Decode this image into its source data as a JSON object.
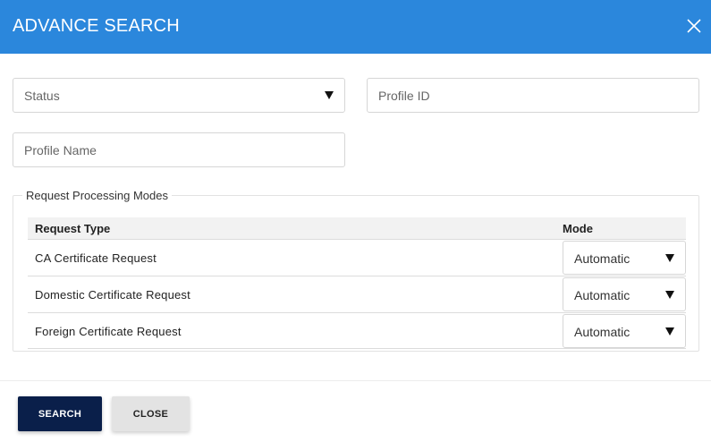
{
  "dialog": {
    "title": "ADVANCE SEARCH",
    "close_icon": "close-icon"
  },
  "filters": {
    "status": {
      "placeholder": "Status",
      "icon": "caret-down-icon"
    },
    "profile_id": {
      "placeholder": "Profile ID"
    },
    "profile_name": {
      "placeholder": "Profile Name"
    }
  },
  "modes": {
    "legend": "Request Processing Modes",
    "columns": {
      "request_type": "Request Type",
      "mode": "Mode"
    },
    "rows": [
      {
        "request_type": "CA Certificate Request",
        "mode": "Automatic"
      },
      {
        "request_type": "Domestic Certificate Request",
        "mode": "Automatic"
      },
      {
        "request_type": "Foreign Certificate Request",
        "mode": "Automatic"
      }
    ]
  },
  "footer": {
    "search_label": "SEARCH",
    "close_label": "CLOSE"
  },
  "colors": {
    "header": "#2b87dc",
    "primary_button": "#0a1f4a",
    "secondary_button": "#e3e3e3"
  }
}
